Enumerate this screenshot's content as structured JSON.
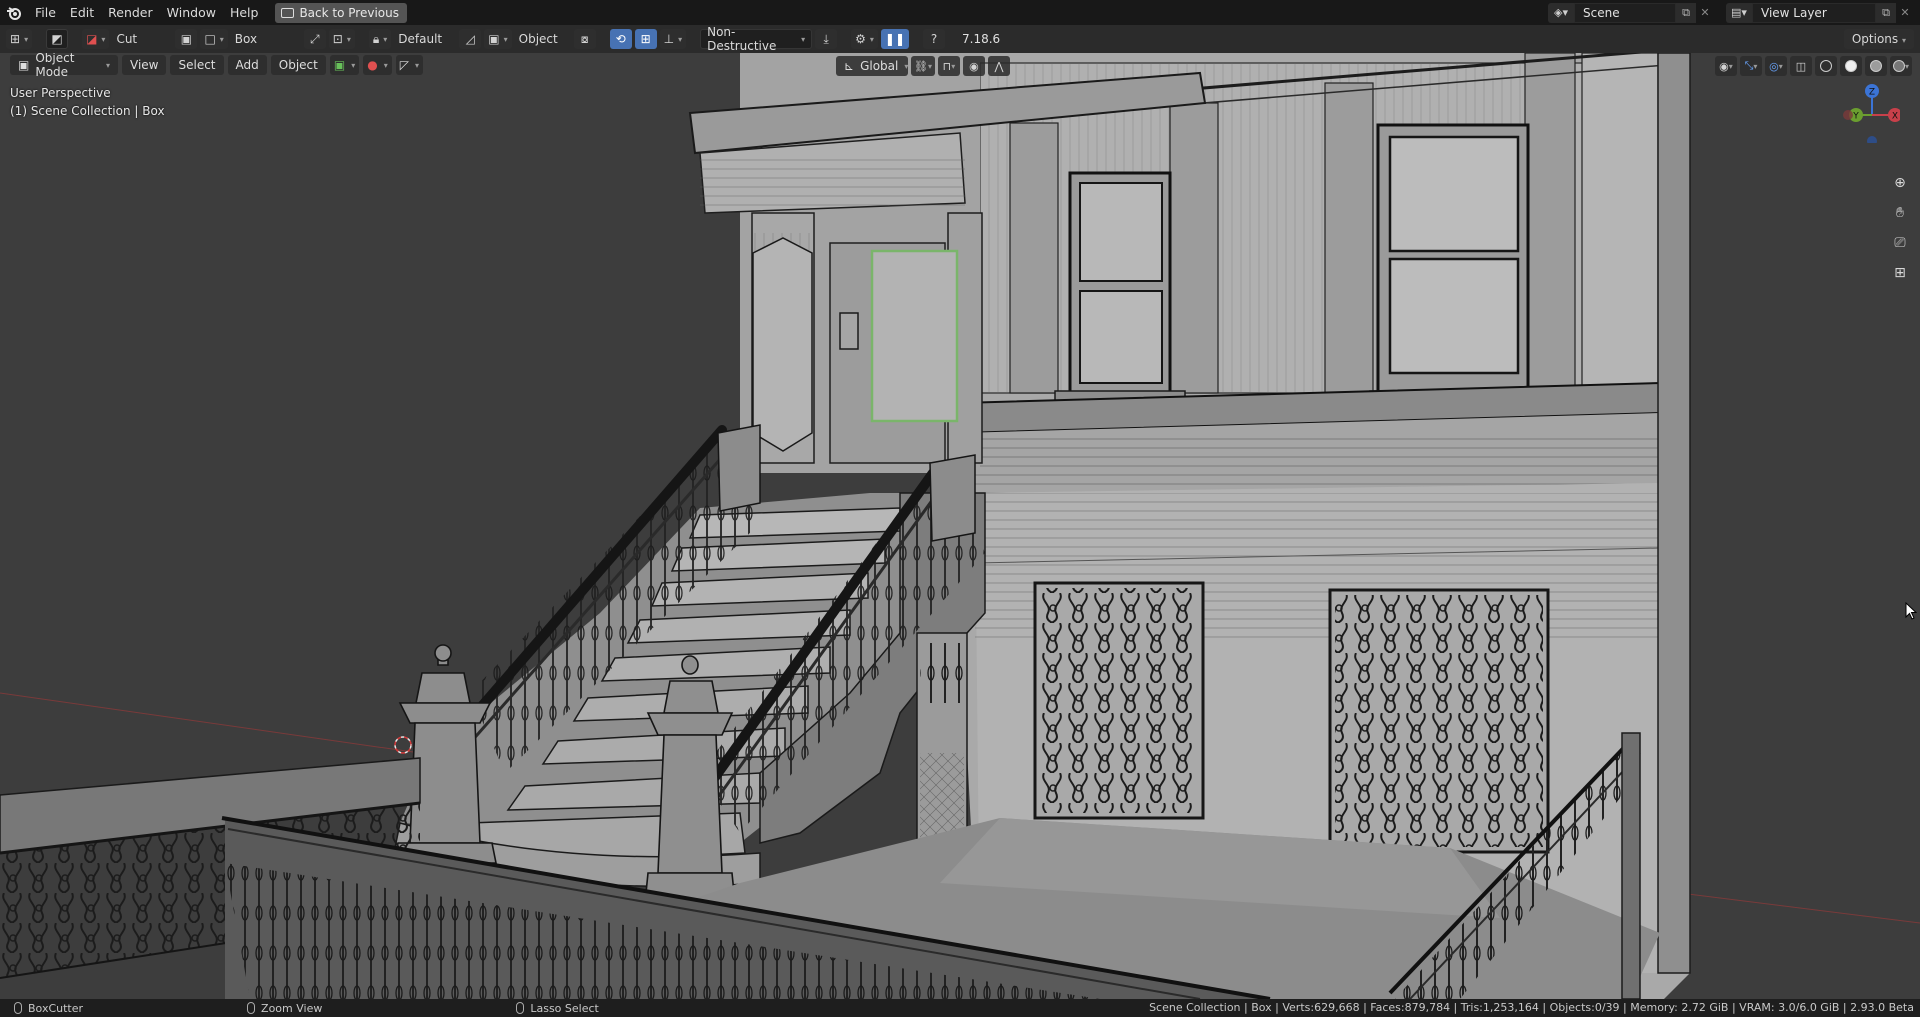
{
  "menu": {
    "items": [
      "File",
      "Edit",
      "Render",
      "Window",
      "Help"
    ],
    "back_button": "Back to Previous"
  },
  "workspace": {
    "scene_label": "Scene",
    "view_layer_label": "View Layer"
  },
  "tool_header": {
    "operation": "Cut",
    "shape": "Box",
    "orientation_mode": "Default",
    "object_label": "Object",
    "boolean_mode": "Non-Destructive",
    "version": "7.18.6",
    "options": "Options"
  },
  "viewport_header": {
    "mode": "Object Mode",
    "menus": [
      "View",
      "Select",
      "Add",
      "Object"
    ],
    "transform_orientation": "Global"
  },
  "viewport_info": {
    "perspective": "User Perspective",
    "collection": "(1) Scene Collection | Box"
  },
  "gizmo": {
    "z": "Z",
    "x": "X",
    "y": "Y"
  },
  "statusbar": {
    "left_action": "BoxCutter",
    "middle_action": "Zoom View",
    "right_action": "Lasso Select",
    "stats": "Scene Collection | Box | Verts:629,668 | Faces:879,784 | Tris:1,253,164 | Objects:0/39 | Memory: 2.72 GiB | VRAM: 3.0/6.0 GiB | 2.93.0 Beta"
  },
  "colors": {
    "accent": "#4772b3",
    "viewport_bg": "#3d3d3d",
    "axis_x": "#c8404a",
    "axis_y": "#6b9e2f",
    "axis_z": "#3b74d6"
  }
}
